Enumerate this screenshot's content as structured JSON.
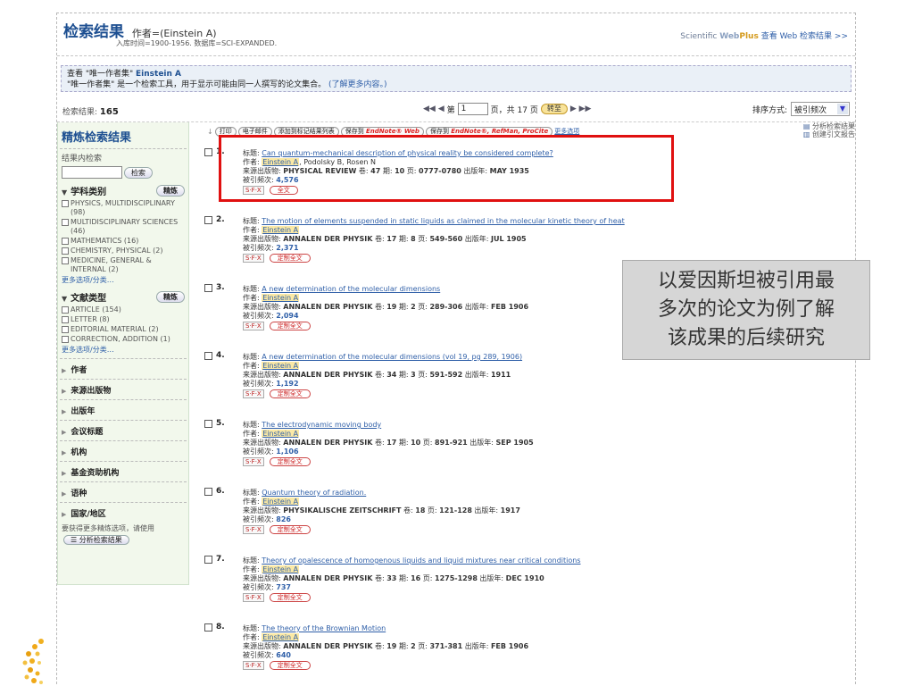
{
  "header": {
    "title": "检索结果",
    "query": "作者=(Einstein A)",
    "subline": "入库时间=1900-1956. 数据库=SCI-EXPANDED.",
    "webplus_brand1": "Scientific ",
    "webplus_brand2": "Web",
    "webplus_brand3": "Plus",
    "webplus_link": "查看 Web 检索结果 >>"
  },
  "notice": {
    "line1_prefix": "查看 \"唯一作者集\" ",
    "line1_name": "Einstein A",
    "line2": "\"唯一作者集\" 是一个检索工具，用于显示可能由同一人撰写的论文集合。",
    "line2_link": "(了解更多内容。)"
  },
  "pager": {
    "count_label": "检索结果:",
    "count": "165",
    "first_prev": "◀◀ ◀",
    "page_label": "第",
    "page_value": "1",
    "of_label": "页，共 17 页",
    "go_label": "转至",
    "next_last": "▶ ▶▶",
    "sort_label": "排序方式:",
    "sort_value": "被引频次"
  },
  "left": {
    "title": "精炼检索结果",
    "within_label": "结果内检索",
    "search_btn": "检索",
    "refine_btn": "精炼",
    "subject_label": "学科类别",
    "subjects": [
      {
        "label": "PHYSICS, MULTIDISCIPLINARY (98)"
      },
      {
        "label": "MULTIDISCIPLINARY SCIENCES (46)"
      },
      {
        "label": "MATHEMATICS (16)"
      },
      {
        "label": "CHEMISTRY, PHYSICAL (2)"
      },
      {
        "label": "MEDICINE, GENERAL & INTERNAL (2)"
      }
    ],
    "more": "更多选项/分类…",
    "doctype_label": "文献类型",
    "doctypes": [
      {
        "label": "ARTICLE (154)"
      },
      {
        "label": "LETTER (8)"
      },
      {
        "label": "EDITORIAL MATERIAL (2)"
      },
      {
        "label": "CORRECTION, ADDITION (1)"
      }
    ],
    "facets": [
      "作者",
      "来源出版物",
      "出版年",
      "会议标题",
      "机构",
      "基金资助机构",
      "语种",
      "国家/地区"
    ],
    "tail": "要获得更多精炼选项，请使用",
    "analyze_btn": "分析检索结果"
  },
  "toolbar": {
    "print": "打印",
    "email": "电子邮件",
    "add_marked": "添加到标记结果列表",
    "save_prefix": "保存到",
    "endnote_web": "EndNote® Web",
    "endnote_desktop": "EndNote®, RefMan, ProCite",
    "more": "更多选项",
    "analyze": "分析检索结果",
    "citation_report": "创建引文报告"
  },
  "labels": {
    "title": "标题: ",
    "author": "作者: ",
    "source": "来源出版物: ",
    "vol": " 卷: ",
    "issue": " 期: ",
    "page": " 页: ",
    "year": " 出版年: ",
    "cited": "被引频次: ",
    "sfx": "S·F·X",
    "fulltext": "全文",
    "custom_fulltext": "定制全文"
  },
  "records": [
    {
      "num": "1.",
      "title": "Can quantum-mechanical description of physical reality be considered complete?",
      "authors_main": "Einstein A",
      "authors_rest": ", Podolsky B, Rosen N",
      "journal": "PHYSICAL REVIEW",
      "vol": "47",
      "issue": "10",
      "pages": "0777-0780",
      "year": "MAY 1935",
      "cited": "4,576"
    },
    {
      "num": "2.",
      "title": "The motion of elements suspended in static liquids as claimed in the molecular kinetic theory of heat",
      "authors_main": "Einstein A",
      "authors_rest": "",
      "journal": "ANNALEN DER PHYSIK",
      "vol": "17",
      "issue": "8",
      "pages": "549-560",
      "year": "JUL 1905",
      "cited": "2,371"
    },
    {
      "num": "3.",
      "title": "A new determination of the molecular dimensions",
      "authors_main": "Einstein A",
      "authors_rest": "",
      "journal": "ANNALEN DER PHYSIK",
      "vol": "19",
      "issue": "2",
      "pages": "289-306",
      "year": "FEB 1906",
      "cited": "2,094"
    },
    {
      "num": "4.",
      "title": "A new determination of the molecular dimensions (vol 19, pg 289, 1906)",
      "authors_main": "Einstein A",
      "authors_rest": "",
      "journal": "ANNALEN DER PHYSIK",
      "vol": "34",
      "issue": "3",
      "pages": "591-592",
      "year": "1911",
      "cited": "1,192"
    },
    {
      "num": "5.",
      "title": "The electrodynamic moving body",
      "authors_main": "Einstein A",
      "authors_rest": "",
      "journal": "ANNALEN DER PHYSIK",
      "vol": "17",
      "issue": "10",
      "pages": "891-921",
      "year": "SEP 1905",
      "cited": "1,106"
    },
    {
      "num": "6.",
      "title": "Quantum theory of radiation.",
      "authors_main": "Einstein A",
      "authors_rest": "",
      "journal": "PHYSIKALISCHE ZEITSCHRIFT",
      "vol": "18",
      "issue": "",
      "pages": "121-128",
      "year": "1917",
      "cited": "826"
    },
    {
      "num": "7.",
      "title": "Theory of opalescence of homogenous liquids and liquid mixtures near critical conditions",
      "authors_main": "Einstein A",
      "authors_rest": "",
      "journal": "ANNALEN DER PHYSIK",
      "vol": "33",
      "issue": "16",
      "pages": "1275-1298",
      "year": "DEC 1910",
      "cited": "737"
    },
    {
      "num": "8.",
      "title": "The theory of the Brownian Motion",
      "authors_main": "Einstein A",
      "authors_rest": "",
      "journal": "ANNALEN DER PHYSIK",
      "vol": "19",
      "issue": "2",
      "pages": "371-381",
      "year": "FEB 1906",
      "cited": "640"
    }
  ],
  "callout": {
    "line1": "以爱因斯坦被引用最",
    "line2": "多次的论文为例了解",
    "line3": "该成果的后续研究"
  },
  "colors": {
    "highlight": "#e01010",
    "accent": "#1d4f91",
    "link": "#2f5fa8"
  }
}
